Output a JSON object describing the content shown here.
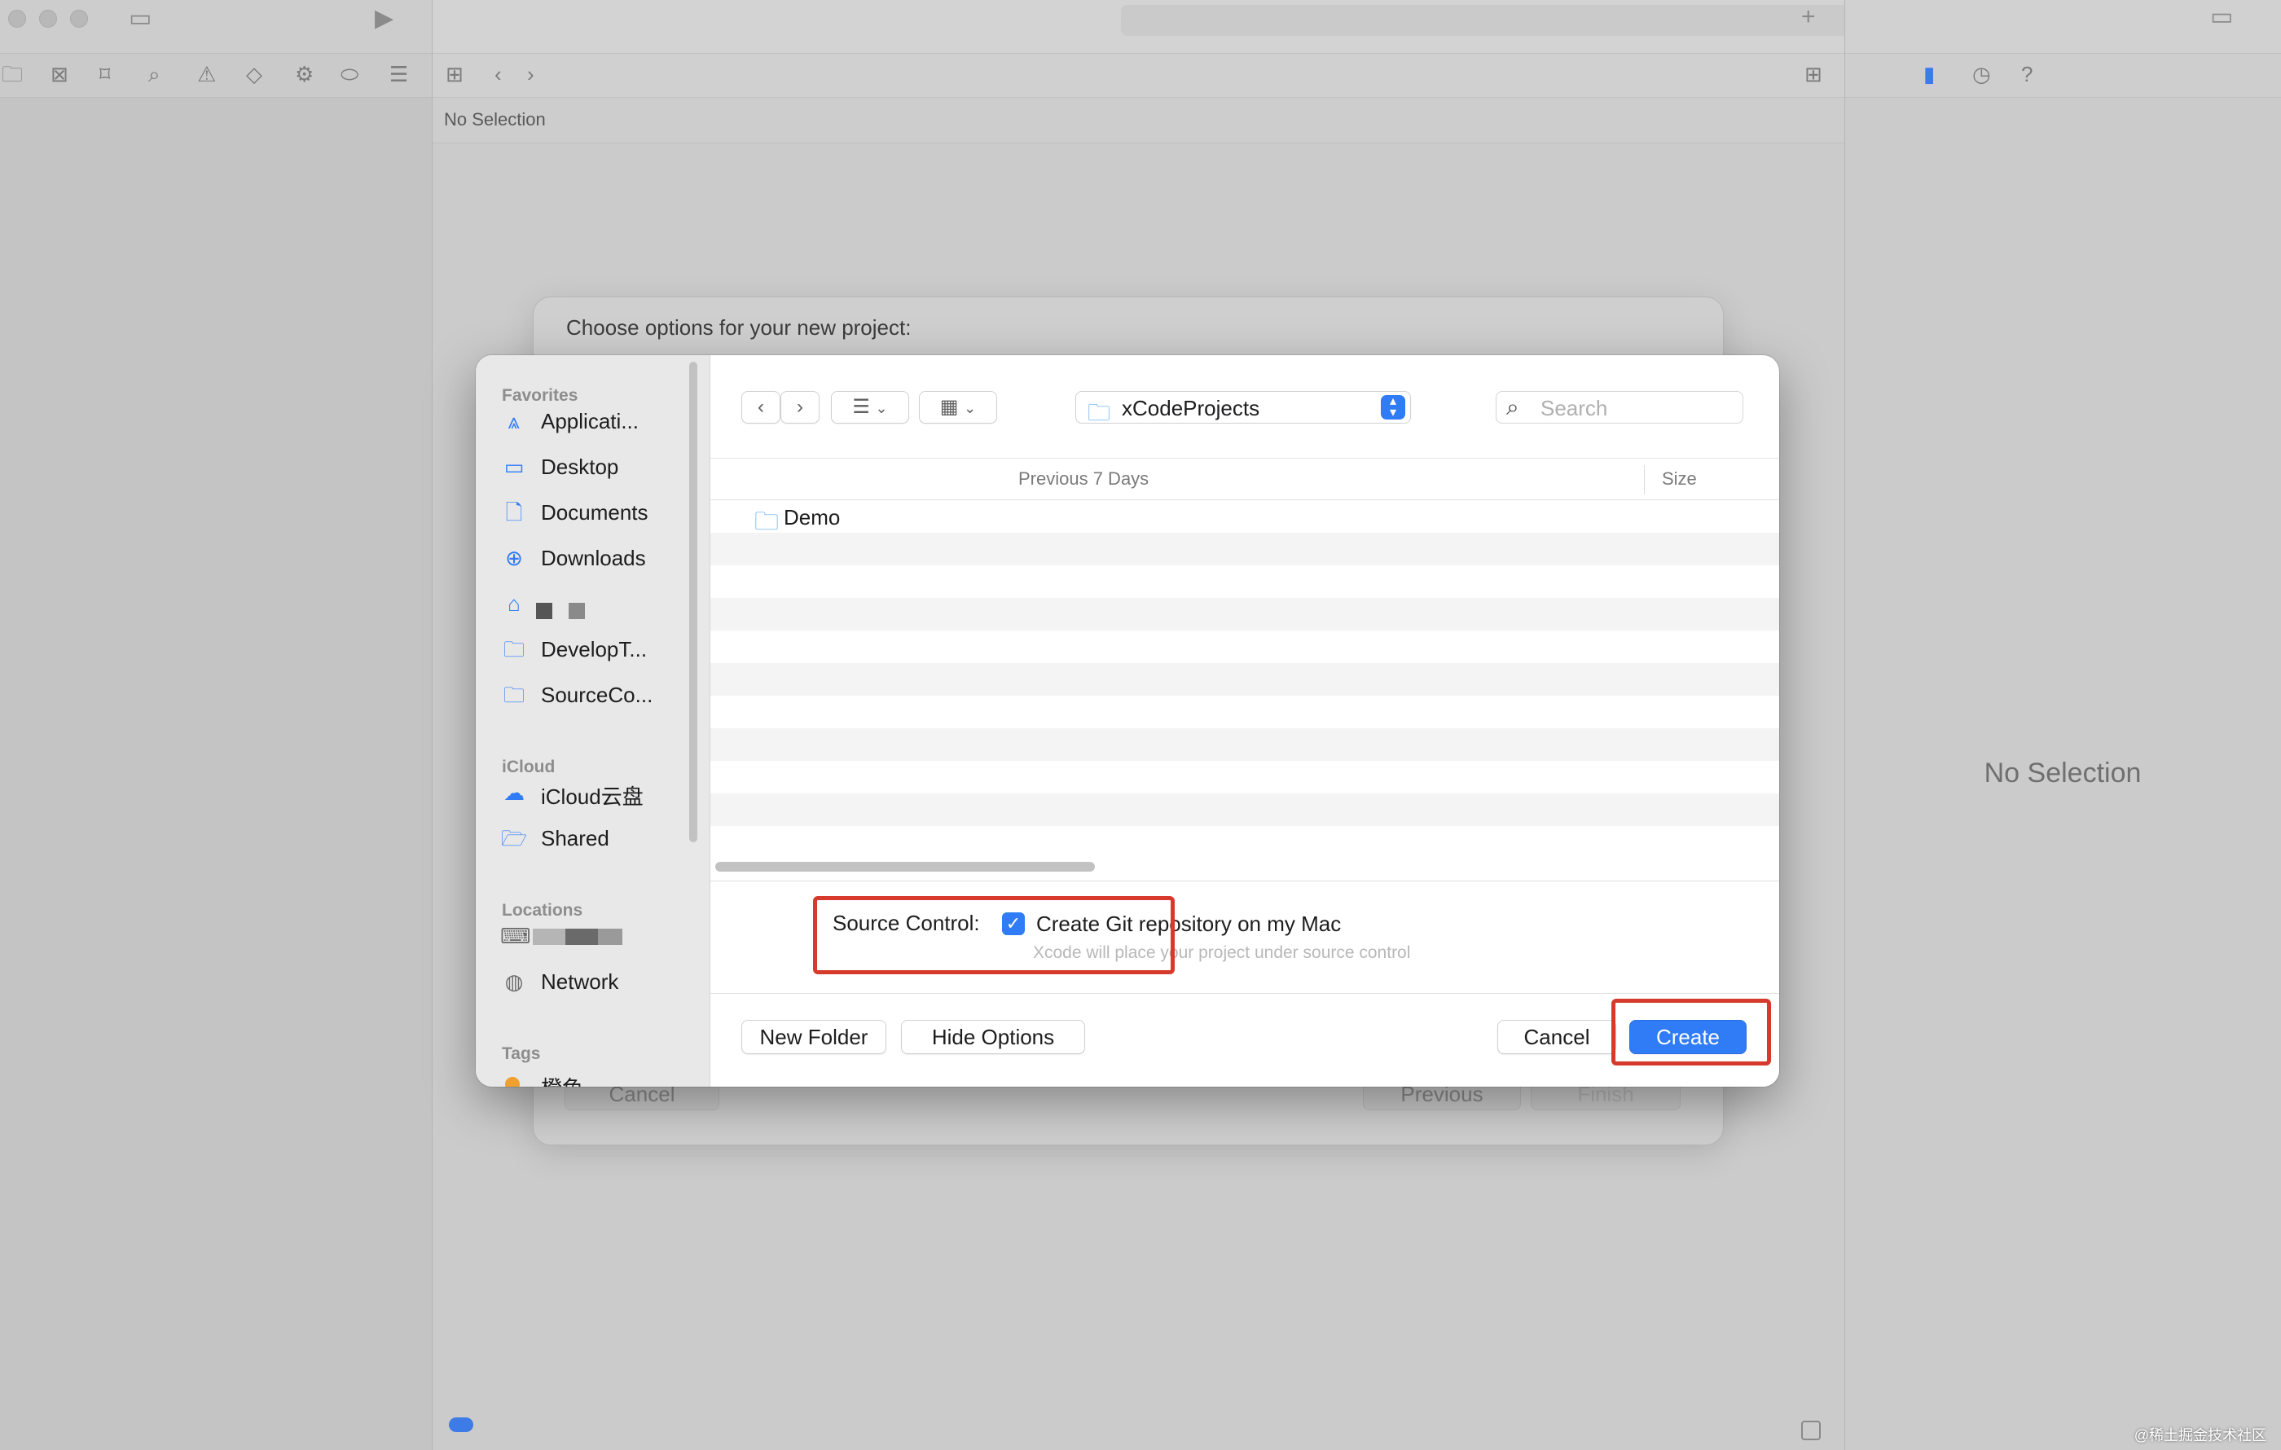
{
  "editor": {
    "breadcrumb": "No Selection",
    "inspector_empty": "No Selection"
  },
  "back_sheet": {
    "title": "Choose options for your new project:",
    "cancel_label": "Cancel",
    "previous_label": "Previous",
    "finish_label": "Finish"
  },
  "dialog": {
    "sidebar": {
      "favorites_title": "Favorites",
      "items": [
        {
          "label": "Applicati...",
          "icon": "applications-icon"
        },
        {
          "label": "Desktop",
          "icon": "desktop-icon"
        },
        {
          "label": "Documents",
          "icon": "document-icon"
        },
        {
          "label": "Downloads",
          "icon": "downloads-icon"
        },
        {
          "label": "",
          "icon": "home-icon"
        },
        {
          "label": "DevelopT...",
          "icon": "folder-icon"
        },
        {
          "label": "SourceCo...",
          "icon": "folder-icon"
        }
      ],
      "icloud_title": "iCloud",
      "icloud_items": [
        {
          "label": "iCloud云盘",
          "icon": "cloud-icon"
        },
        {
          "label": "Shared",
          "icon": "shared-folder-icon"
        }
      ],
      "locations_title": "Locations",
      "location_items": [
        {
          "label": "",
          "icon": "laptop-icon"
        },
        {
          "label": "Network",
          "icon": "globe-icon"
        }
      ],
      "tags_title": "Tags",
      "tag_partial": "橙色"
    },
    "location": "xCodeProjects",
    "search_placeholder": "Search",
    "columns": {
      "group": "Previous 7 Days",
      "size": "Size"
    },
    "files": [
      {
        "name": "Demo",
        "icon": "folder-icon"
      }
    ],
    "source_control": {
      "label": "Source Control:",
      "checkbox_label": "Create Git repository on my Mac",
      "checked": true,
      "help_text": "Xcode will place your project under source control"
    },
    "buttons": {
      "new_folder": "New Folder",
      "hide_options": "Hide Options",
      "cancel": "Cancel",
      "create": "Create"
    }
  },
  "watermark": "@稀土掘金技术社区",
  "colors": {
    "accent": "#2f7cf6",
    "annotation": "#d63a2c"
  }
}
